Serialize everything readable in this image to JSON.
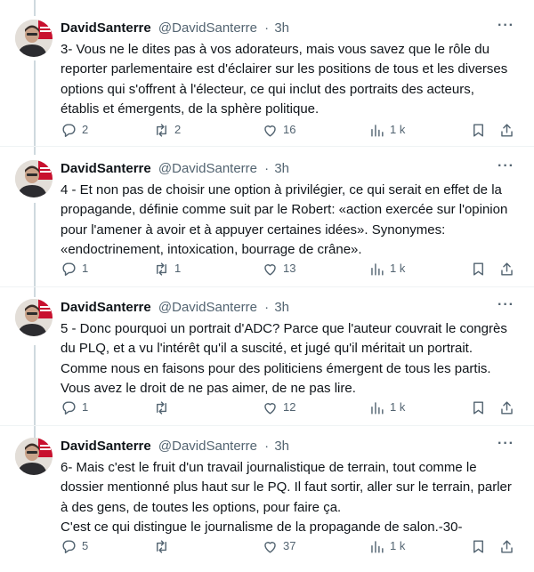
{
  "colors": {
    "text": "#0f1419",
    "secondary": "#536471",
    "line": "#cfd9de",
    "brand_red": "#c8102e"
  },
  "icons": {
    "reply": "reply-icon",
    "retweet": "retweet-icon",
    "like": "heart-icon",
    "views": "views-chart-icon",
    "bookmark": "bookmark-icon",
    "share": "share-icon",
    "more": "more-dots-icon"
  },
  "tweets": [
    {
      "name": "DavidSanterre",
      "handle": "@DavidSanterre",
      "sep": "·",
      "time": "3h",
      "more": "···",
      "avatar_badge": "PRESSE",
      "text": "3- Vous ne le dites pas à vos adorateurs, mais vous savez que le rôle du reporter parlementaire est d'éclairer sur les positions de tous et les diverses options qui s'offrent à l'électeur, ce qui inclut des portraits des acteurs, établis et émergents, de la sphère politique.",
      "replies": "2",
      "retweets": "2",
      "likes": "16",
      "views": "1 k"
    },
    {
      "name": "DavidSanterre",
      "handle": "@DavidSanterre",
      "sep": "·",
      "time": "3h",
      "more": "···",
      "avatar_badge": "PRESSE",
      "text": "4 - Et non pas de choisir une option à privilégier, ce qui serait en effet de la propagande, définie comme suit par le Robert: «action exercée sur l'opinion pour l'amener à avoir et à appuyer certaines idées». Synonymes: «endoctrinement, intoxication, bourrage de crâne».",
      "replies": "1",
      "retweets": "1",
      "likes": "13",
      "views": "1 k"
    },
    {
      "name": "DavidSanterre",
      "handle": "@DavidSanterre",
      "sep": "·",
      "time": "3h",
      "more": "···",
      "avatar_badge": "PRESSE",
      "text": "5 - Donc pourquoi un portrait d'ADC? Parce que l'auteur couvrait le congrès du PLQ, et a vu l'intérêt qu'il a suscité, et jugé qu'il méritait un portrait. Comme nous en faisons pour des politiciens émergent de tous les partis. Vous avez le droit de ne pas aimer, de ne pas lire.",
      "replies": "1",
      "retweets": "",
      "likes": "12",
      "views": "1 k"
    },
    {
      "name": "DavidSanterre",
      "handle": "@DavidSanterre",
      "sep": "·",
      "time": "3h",
      "more": "···",
      "avatar_badge": "PRESSE",
      "text": "6- Mais c'est le fruit d'un travail journalistique de terrain, tout comme le dossier mentionné plus haut sur le PQ. Il faut sortir, aller sur le terrain, parler à des gens, de toutes les options, pour faire ça.\nC'est ce qui distingue le journalisme de la propagande de salon.-30-",
      "replies": "5",
      "retweets": "",
      "likes": "37",
      "views": "1 k"
    }
  ]
}
